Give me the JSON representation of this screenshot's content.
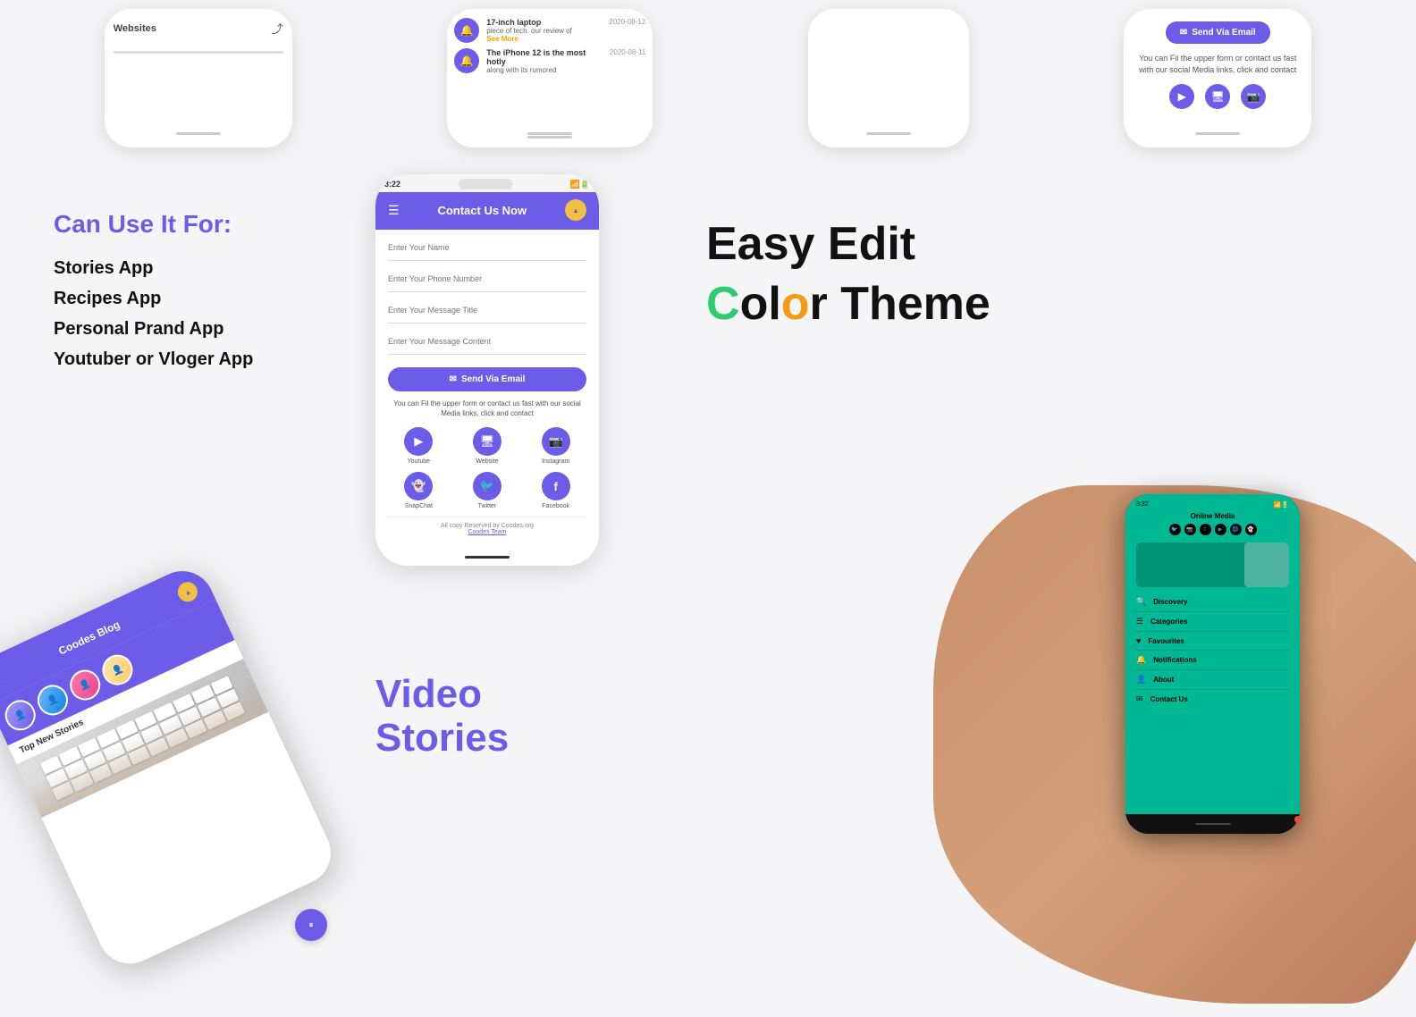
{
  "top": {
    "websites_label": "Websites",
    "notification1": {
      "title": "17-inch laptop",
      "body": "piece of tech. our review of",
      "see_more": "See More",
      "date": "2020-08-12"
    },
    "notification2": {
      "title": "The iPhone 12 is the most hotly",
      "body": "along with its rumored",
      "date": "2020-08-11"
    },
    "send_via_email": "Send Via Email",
    "contact_desc": "You can Fil the upper form or contact us fast with our social Media links, click and contact"
  },
  "middle": {
    "can_use_title": "Can Use It For:",
    "use_items": [
      "Stories App",
      "Recipes App",
      "Personal Prand App",
      "Youtuber or Vloger App"
    ],
    "contact_header": "Contact Us Now",
    "form": {
      "name_placeholder": "Enter Your Name",
      "phone_placeholder": "Enter Your Phone Number",
      "message_title_placeholder": "Enter Your Message Title",
      "message_content_placeholder": "Enter Your Message Content"
    },
    "send_btn": "Send Via Email",
    "phone_desc": "You can Fil the upper form or contact us fast with our social Media links, click and contact",
    "social_items": [
      {
        "label": "Youtube",
        "icon": "▶"
      },
      {
        "label": "Website",
        "icon": "🖥"
      },
      {
        "label": "Instagram",
        "icon": "📷"
      },
      {
        "label": "SnapChat",
        "icon": "👻"
      },
      {
        "label": "Twitter",
        "icon": "🐦"
      },
      {
        "label": "Facebook",
        "icon": "f"
      }
    ],
    "footer_text": "All copy Reserved by Coodes.org",
    "footer_team": "Coodes Team",
    "easy_edit": "Easy Edit",
    "color_theme": "Color Theme",
    "time": "3:22"
  },
  "bottom": {
    "video_stories_line1": "Video",
    "video_stories_line2": "Stories",
    "app_label": "Coodes Blog",
    "top_stories": "Top New Stories",
    "online_media": "Online Media",
    "menu_items": [
      {
        "label": "Discovery",
        "icon": "🔍"
      },
      {
        "label": "Categories",
        "icon": "☰"
      },
      {
        "label": "Favourites",
        "icon": "♥"
      },
      {
        "label": "Notifications",
        "icon": "🔔"
      },
      {
        "label": "About",
        "icon": "👤"
      },
      {
        "label": "Contact Us",
        "icon": "✉"
      }
    ],
    "green_time": "3:32"
  },
  "colors": {
    "purple": "#6c5ce7",
    "green": "#00b894",
    "orange": "#f39c12",
    "yellow": "#f0c040"
  }
}
